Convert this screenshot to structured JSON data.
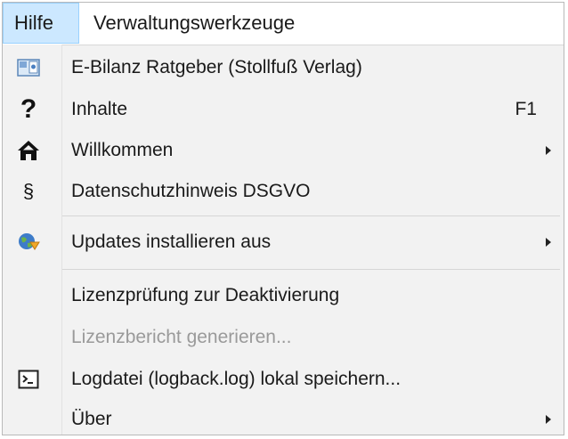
{
  "menubar": {
    "items": [
      {
        "label": "Hilfe"
      },
      {
        "label": "Verwaltungswerkzeuge"
      }
    ]
  },
  "menu": {
    "items": [
      {
        "label": "E-Bilanz Ratgeber (Stollfuß Verlag)",
        "icon": "book-icon"
      },
      {
        "label": "Inhalte",
        "shortcut": "F1",
        "icon": "question-mark-icon"
      },
      {
        "label": "Willkommen",
        "icon": "home-icon",
        "submenu": true
      },
      {
        "label": "Datenschutzhinweis DSGVO",
        "icon": "section-sign-icon",
        "icon_text": "§"
      },
      {
        "label": "Updates installieren aus",
        "icon": "globe-update-icon",
        "submenu": true
      },
      {
        "label": "Lizenzprüfung zur Deaktivierung"
      },
      {
        "label": "Lizenzbericht generieren...",
        "disabled": true
      },
      {
        "label": "Logdatei (logback.log) lokal speichern...",
        "icon": "console-icon"
      },
      {
        "label": "Über",
        "submenu": true
      }
    ]
  },
  "colors": {
    "menubar_active_bg": "#cce8ff",
    "menu_bg": "#f2f2f2",
    "disabled_text": "#9a9a9a"
  }
}
